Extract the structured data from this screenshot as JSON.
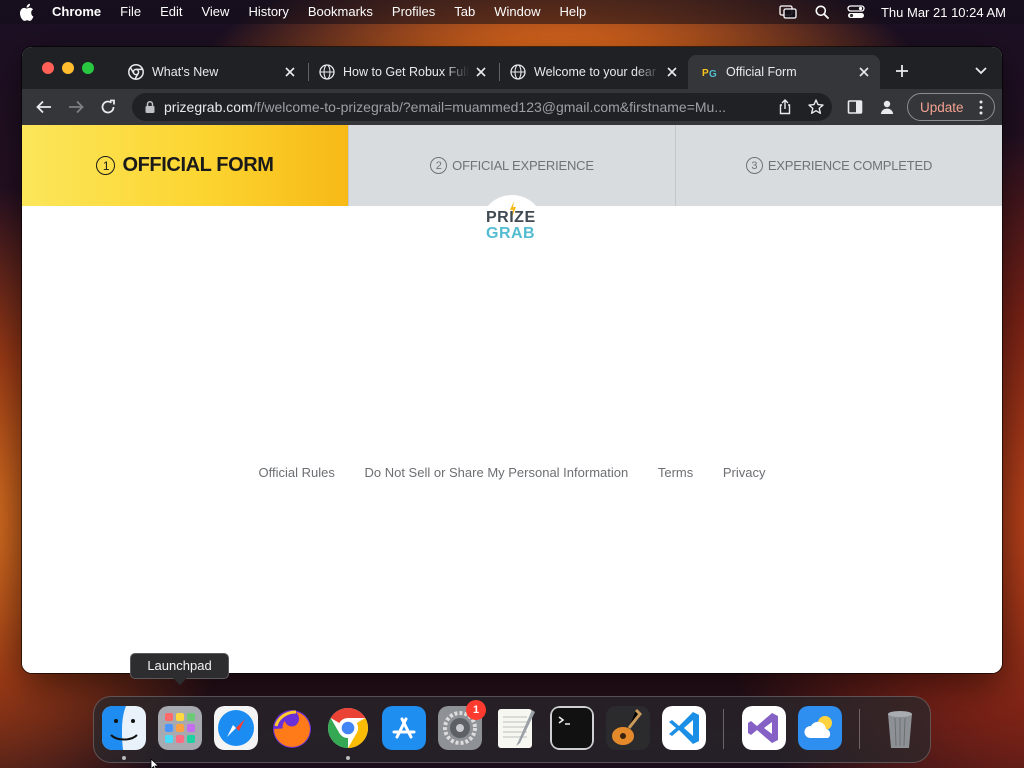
{
  "menubar": {
    "items": [
      "Chrome",
      "File",
      "Edit",
      "View",
      "History",
      "Bookmarks",
      "Profiles",
      "Tab",
      "Window",
      "Help"
    ],
    "clock": "Thu Mar 21  10:24 AM"
  },
  "browser": {
    "tabs": [
      {
        "title": "What's New",
        "favicon": "chrome-icon"
      },
      {
        "title": "How to Get Robux Full",
        "favicon": "globe-icon"
      },
      {
        "title": "Welcome to your dear",
        "favicon": "globe-icon"
      },
      {
        "title": "Official Form",
        "favicon": "prizegrab-favicon",
        "active": true
      }
    ],
    "url_host": "prizegrab.com",
    "url_path": "/f/welcome-to-prizegrab/?email=muammed123@gmail.com&firstname=Mu...",
    "update_label": "Update"
  },
  "page": {
    "steps": [
      {
        "num": "1",
        "label": "OFFICIAL FORM",
        "active": true
      },
      {
        "num": "2",
        "label": "OFFICIAL EXPERIENCE"
      },
      {
        "num": "3",
        "label": "EXPERIENCE COMPLETED"
      }
    ],
    "logo": {
      "line1": "PRIZE",
      "line2": "GRAB"
    },
    "footer_links": [
      "Official Rules",
      "Do Not Sell or Share My Personal Information",
      "Terms",
      "Privacy"
    ]
  },
  "dock": {
    "tooltip": "Launchpad",
    "apps": [
      "finder-icon",
      "launchpad-icon",
      "safari-icon",
      "firefox-icon",
      "chrome-icon",
      "app-store-icon",
      "system-settings-icon",
      "textedit-icon",
      "terminal-icon",
      "garageband-icon",
      "vscode-icon",
      "visual-studio-icon",
      "weather-icon",
      "trash-icon"
    ],
    "settings_badge": "1"
  },
  "colors": {
    "active_step": "#fcd531",
    "update_text": "#f2a18f",
    "logo_dark": "#3f4a52",
    "logo_teal": "#53bcd0"
  }
}
